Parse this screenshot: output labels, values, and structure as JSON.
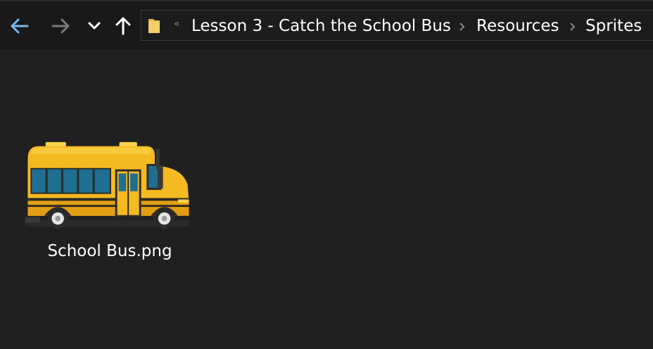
{
  "nav": {
    "back_icon": "arrow-left-icon",
    "forward_icon": "arrow-right-icon",
    "recent_icon": "chevron-down-icon",
    "up_icon": "arrow-up-icon",
    "back_color": "#76b9ed",
    "forward_color": "#7a7a7a"
  },
  "address": {
    "folder_icon": "folder-icon",
    "overflow_marker": "«",
    "crumbs": [
      {
        "label": "Lesson 3 - Catch the School Bus"
      },
      {
        "label": "Resources"
      },
      {
        "label": "Sprites"
      }
    ]
  },
  "files": [
    {
      "name": "School Bus.png",
      "thumbnail": "school-bus-image"
    }
  ],
  "colors": {
    "background": "#202020",
    "toolbar": "#191919",
    "bus_yellow": "#f5b921",
    "window_blue": "#1f6f93"
  }
}
